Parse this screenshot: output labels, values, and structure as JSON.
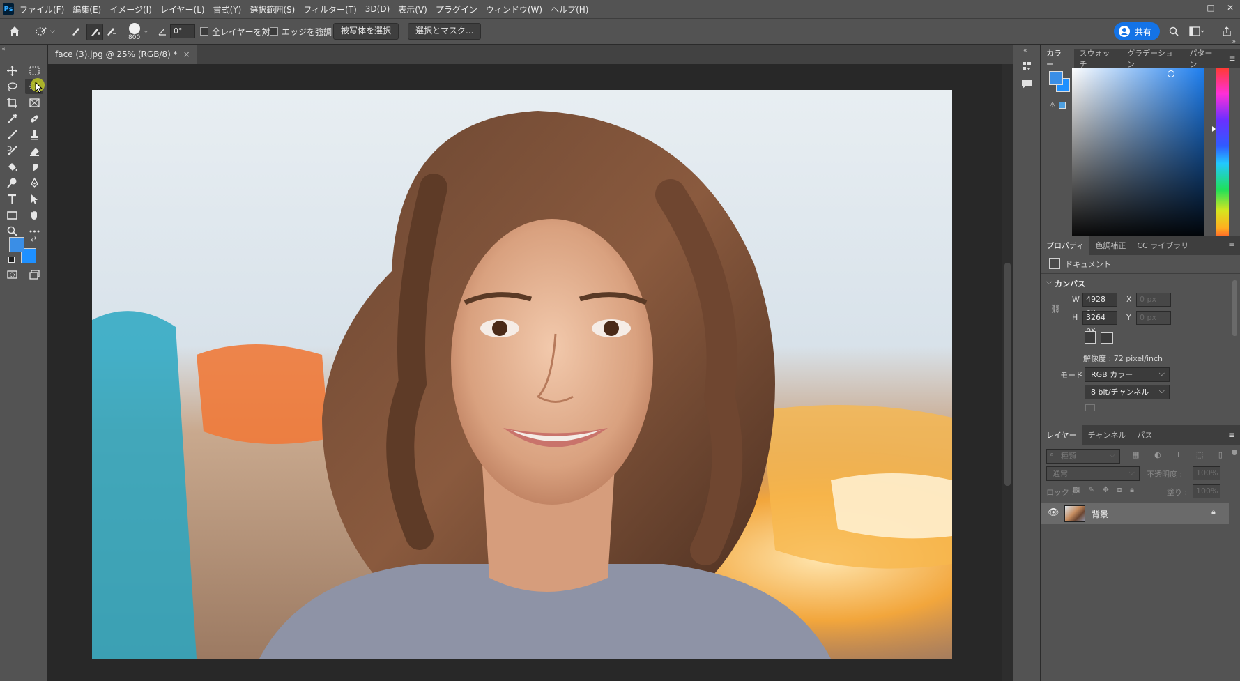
{
  "app": {
    "logo": "Ps"
  },
  "menu": [
    "ファイル(F)",
    "編集(E)",
    "イメージ(I)",
    "レイヤー(L)",
    "書式(Y)",
    "選択範囲(S)",
    "フィルター(T)",
    "3D(D)",
    "表示(V)",
    "プラグイン",
    "ウィンドウ(W)",
    "ヘルプ(H)"
  ],
  "window_controls": {
    "minimize": "—",
    "maximize": "□",
    "close": "✕"
  },
  "options": {
    "brush_size": "800",
    "angle": "0°",
    "sample_all_layers": "全レイヤーを対象",
    "enhance_edge": "エッジを強調",
    "select_subject": "被写体を選択",
    "select_and_mask": "選択とマスク...",
    "share": "共有"
  },
  "document": {
    "tab_title": "face (3).jpg @ 25% (RGB/8) *",
    "close": "×"
  },
  "colors": {
    "foreground": "#3a8ee6",
    "background": "#1e90ff",
    "accent": "#1473e6"
  },
  "panels": {
    "color_tabs": [
      "カラー",
      "スウォッチ",
      "グラデーション",
      "パターン"
    ],
    "properties_tabs": [
      "プロパティ",
      "色調補正",
      "CC ライブラリ"
    ],
    "layers_tabs": [
      "レイヤー",
      "チャンネル",
      "パス"
    ]
  },
  "properties": {
    "doc_label": "ドキュメント",
    "canvas_section": "カンバス",
    "w_label": "W",
    "w_value": "4928 px",
    "h_label": "H",
    "h_value": "3264 px",
    "x_label": "X",
    "x_value": "0 px",
    "y_label": "Y",
    "y_value": "0 px",
    "resolution": "解像度 : 72 pixel/inch",
    "mode_label": "モード",
    "mode_value": "RGB カラー",
    "depth_value": "8 bit/チャンネル"
  },
  "layers": {
    "filter_placeholder": "種類",
    "blend_mode": "通常",
    "opacity_label": "不透明度 :",
    "opacity_value": "100%",
    "lock_label": "ロック :",
    "fill_label": "塗り :",
    "fill_value": "100%",
    "items": [
      {
        "name": "背景",
        "visible": true,
        "locked": true
      }
    ]
  }
}
